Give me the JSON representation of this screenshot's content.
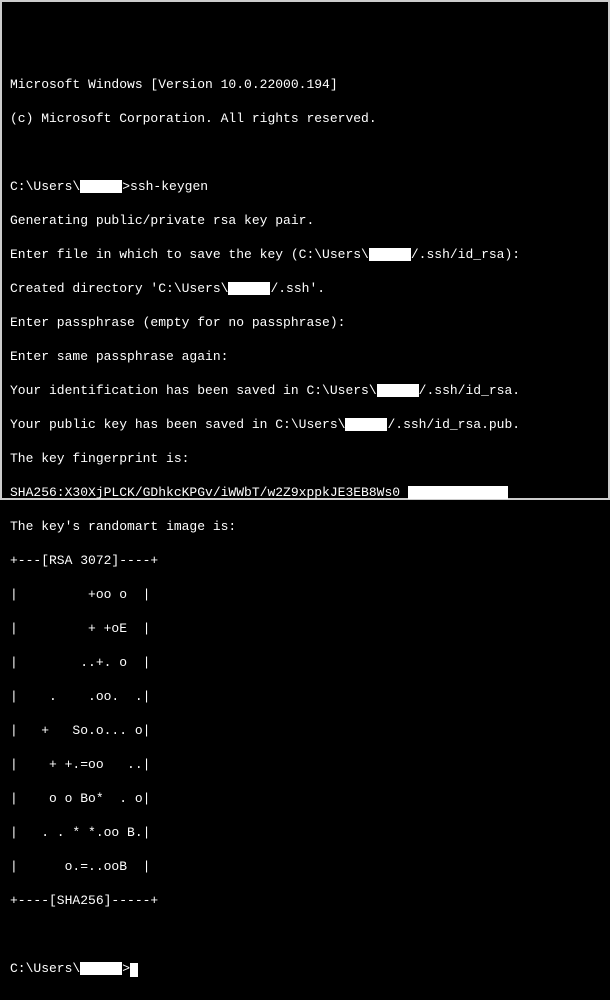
{
  "header": {
    "version_line": "Microsoft Windows [Version 10.0.22000.194]",
    "copyright_line": "(c) Microsoft Corporation. All rights reserved."
  },
  "prompt": {
    "prefix": "C:\\Users\\",
    "suffix": ">"
  },
  "command": "ssh-keygen",
  "output": {
    "generating": "Generating public/private rsa key pair.",
    "enter_file_prefix": "Enter file in which to save the key (C:\\Users\\",
    "enter_file_suffix": "/.ssh/id_rsa):",
    "created_dir_prefix": "Created directory 'C:\\Users\\",
    "created_dir_suffix": "/.ssh'.",
    "enter_passphrase": "Enter passphrase (empty for no passphrase):",
    "enter_passphrase_again": "Enter same passphrase again:",
    "identification_prefix": "Your identification has been saved in C:\\Users\\",
    "identification_suffix": "/.ssh/id_rsa.",
    "public_key_prefix": "Your public key has been saved in C:\\Users\\",
    "public_key_suffix": "/.ssh/id_rsa.pub.",
    "fingerprint_label": "The key fingerprint is:",
    "fingerprint_value": "SHA256:X30XjPLCK/GDhkcKPGv/iWWbT/w2Z9xppkJE3EB8Ws0 ",
    "randomart_label": "The key's randomart image is:"
  },
  "randomart": [
    "+---[RSA 3072]----+",
    "|         +oo o  |",
    "|         + +oE  |",
    "|        ..+. o  |",
    "|    .    .oo.  .|",
    "|   +   So.o... o|",
    "|    + +.=oo   ..|",
    "|    o o Bo*  . o|",
    "|   . . * *.oo B.|",
    "|      o.=..ooB  |",
    "+----[SHA256]-----+"
  ]
}
